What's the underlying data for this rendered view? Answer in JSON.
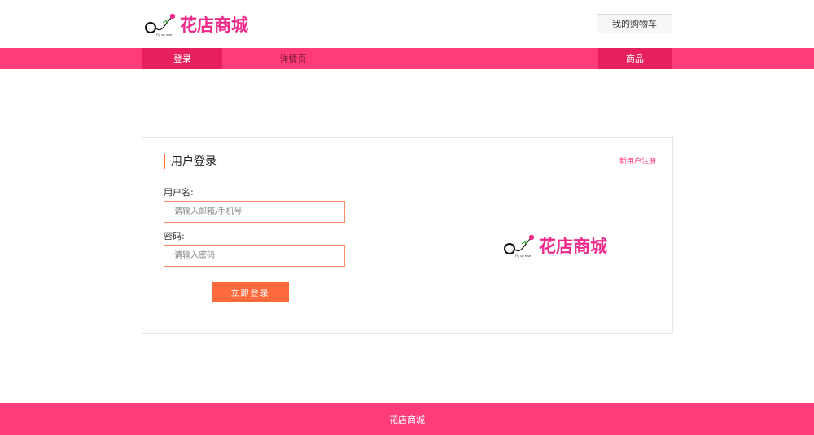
{
  "header": {
    "logo_text": "花店商城",
    "logo_tagline": "Fly up rose",
    "cart_label": "我的购物车"
  },
  "nav": {
    "login": "登录",
    "detail": "详情页",
    "goods": "商品"
  },
  "login_card": {
    "title": "用户登录",
    "register_link": "新用户注册",
    "username_label": "用户名:",
    "username_placeholder": "请输入邮箱/手机号",
    "password_label": "密码:",
    "password_placeholder": "请输入密码",
    "submit_label": "立即登录",
    "logo_text": "花店商城"
  },
  "footer": {
    "text": "花店商城"
  },
  "colors": {
    "brand_pink": "#ff3b7a",
    "nav_active": "#e61f5e",
    "logo_pink": "#f0288a",
    "accent_orange": "#ff6a3c"
  }
}
